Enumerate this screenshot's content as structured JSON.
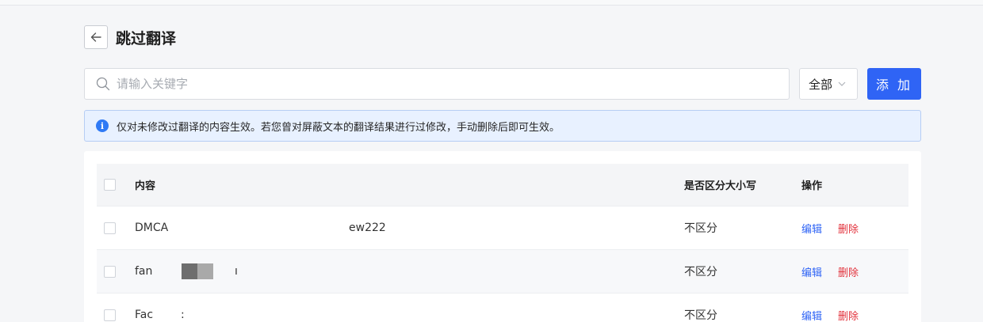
{
  "header": {
    "title": "跳过翻译",
    "back_icon": "arrow-left-icon"
  },
  "toolbar": {
    "search_placeholder": "请输入关键字",
    "search_icon": "search-icon",
    "filter_value": "全部",
    "filter_icon": "chevron-down-icon",
    "add_label": "添 加",
    "accent_color": "#2f64f5"
  },
  "notice": {
    "text": "仅对未修改过翻译的内容生效。若您曾对屏蔽文本的翻译结果进行过修改，手动删除后即可生效。",
    "icon": "info-icon"
  },
  "table": {
    "columns": {
      "content": "内容",
      "case": "是否区分大小写",
      "ops": "操作"
    },
    "rows": [
      {
        "content_start": "DMCA",
        "content_end": "ew222",
        "case": "不区分",
        "edit": "编辑",
        "delete": "删除"
      },
      {
        "content_start": "fan",
        "content_end": "ı",
        "case": "不区分",
        "edit": "编辑",
        "delete": "删除"
      },
      {
        "content_start": "Fac",
        "content_end": ":",
        "case": "不区分",
        "edit": "编辑",
        "delete": "删除"
      }
    ]
  }
}
